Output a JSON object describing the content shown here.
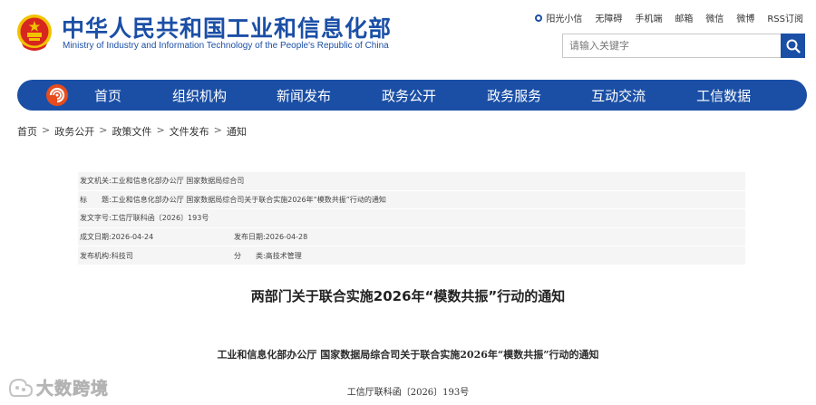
{
  "header": {
    "title_cn": "中华人民共和国工业和信息化部",
    "title_en": "Ministry of Industry and Information Technology of the People's Republic of China",
    "top_links": [
      "阳光小信",
      "无障碍",
      "手机端",
      "邮箱",
      "微信",
      "微博",
      "RSS订阅"
    ]
  },
  "search": {
    "placeholder": "请输入关键字"
  },
  "nav": {
    "items": [
      "首页",
      "组织机构",
      "新闻发布",
      "政务公开",
      "政务服务",
      "互动交流",
      "工信数据"
    ]
  },
  "breadcrumb": [
    "首页",
    "政务公开",
    "政策文件",
    "文件发布",
    "通知"
  ],
  "meta": {
    "issuer_label": "发文机关:",
    "issuer": "工业和信息化部办公厅 国家数据局综合司",
    "title_label": "标　　题:",
    "title": "工业和信息化部办公厅 国家数据局综合司关于联合实施2026年“模数共振”行动的通知",
    "number_label": "发文字号:",
    "number": "工信厅联科函〔2026〕193号",
    "created_label": "成文日期:",
    "created": "2026-04-24",
    "published_label": "发布日期:",
    "published": "2026-04-28",
    "org_label": "发布机构:",
    "org": "科技司",
    "category_label": "分　　类:",
    "category": "高技术管理"
  },
  "document": {
    "title": "两部门关于联合实施2026年“模数共振”行动的通知",
    "subtitle": "工业和信息化部办公厅  国家数据局综合司关于联合实施2026年“模数共振”行动的通知",
    "number": "工信厅联科函〔2026〕193号"
  },
  "watermark": {
    "text": "大数跨境"
  },
  "colors": {
    "brand_blue": "#1b4fa6",
    "emblem_red": "#d7261e",
    "emblem_gold": "#f2c200"
  }
}
